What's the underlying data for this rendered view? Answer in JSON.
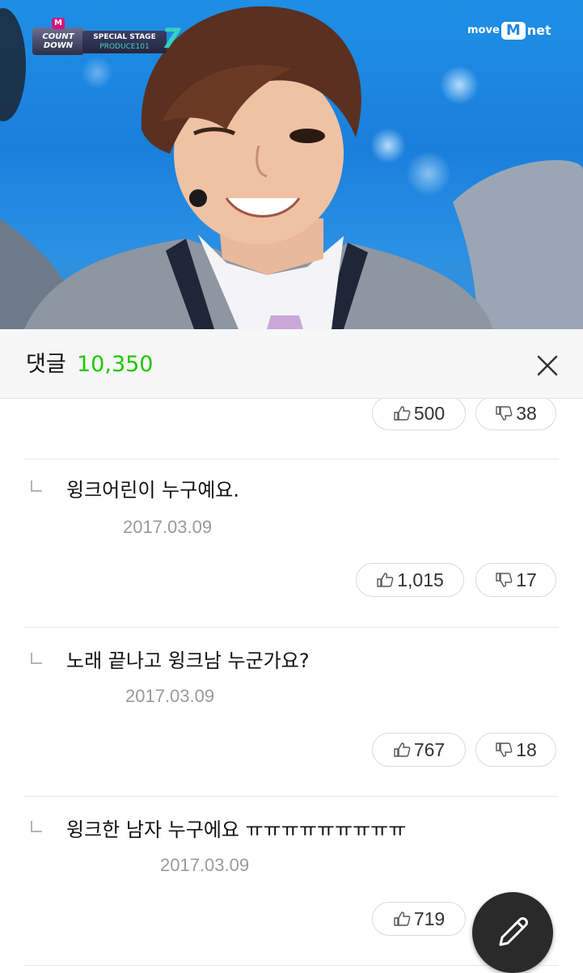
{
  "video": {
    "logo_left": {
      "m": "M",
      "count": "COUNT",
      "down": "DOWN",
      "special": "SPECIAL STAGE",
      "produce": "PRODUCE101",
      "seven": "7"
    },
    "logo_right": {
      "move": "move",
      "m": "M",
      "net": "net"
    }
  },
  "header": {
    "title": "댓글",
    "count": "10,350"
  },
  "comments": [
    {
      "likes": "500",
      "dislikes": "38"
    },
    {
      "text": "윙크어린이 누구예요.",
      "date": "2017.03.09",
      "likes": "1,015",
      "dislikes": "17"
    },
    {
      "text": "노래 끝나고 윙크남 누군가요?",
      "date": "2017.03.09",
      "likes": "767",
      "dislikes": "18"
    },
    {
      "text": "윙크한 남자 누구에요 ㅠㅠㅠㅠㅠㅠㅠㅠㅠ",
      "date": "2017.03.09",
      "likes": "719"
    }
  ],
  "colors": {
    "accent_green": "#1ec800",
    "fab_bg": "#2a2a2a",
    "date_gray": "#9a9a9a"
  }
}
